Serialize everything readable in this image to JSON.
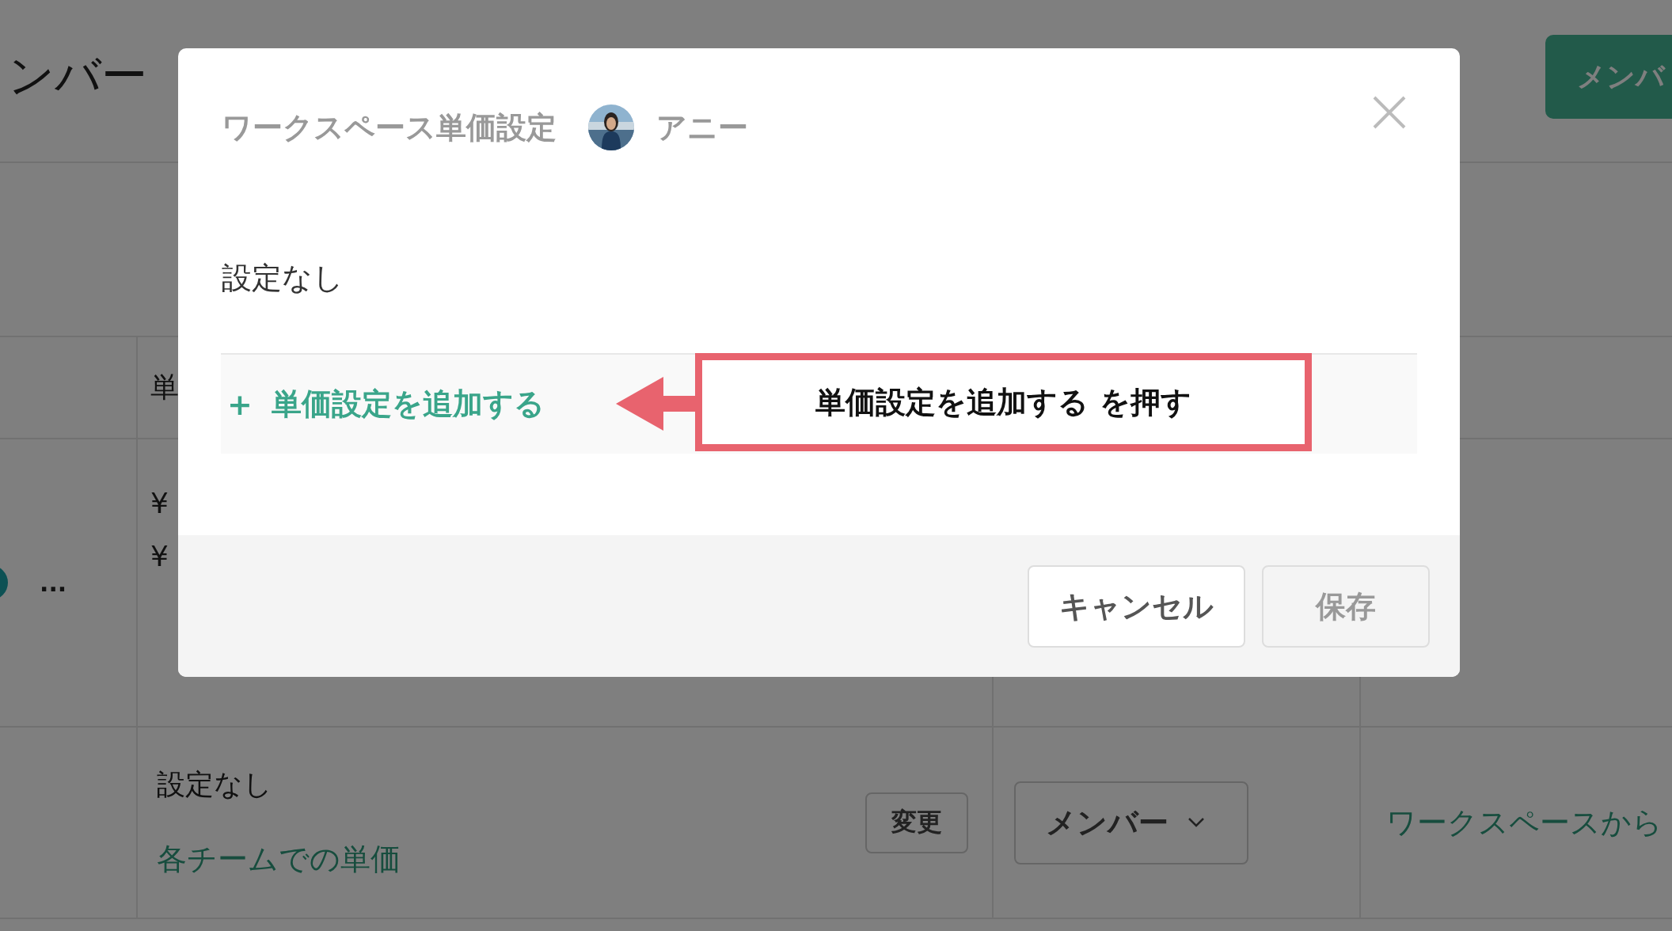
{
  "page": {
    "title": "ンバー",
    "primary_button": "メンバ",
    "table": {
      "header": "単",
      "rows": [
        {
          "kind": "prices",
          "prices": [
            "¥",
            "¥"
          ],
          "more": "..."
        },
        {
          "kind": "unset",
          "price_status": "設定なし",
          "team_link": "各チームでの単価",
          "change_button": "変更",
          "role": "メンバー",
          "remove_link": "ワークスペースから"
        }
      ]
    }
  },
  "dialog": {
    "title": "ワークスペース単価設定",
    "user": "アニー",
    "status": "設定なし",
    "add_button": {
      "icon": "+",
      "label": "単価設定を追加する"
    },
    "buttons": [
      {
        "label": "キャンセル",
        "disabled": false
      },
      {
        "label": "保存",
        "disabled": true
      }
    ]
  },
  "annotation": {
    "text": "単価設定を追加する を押す"
  }
}
